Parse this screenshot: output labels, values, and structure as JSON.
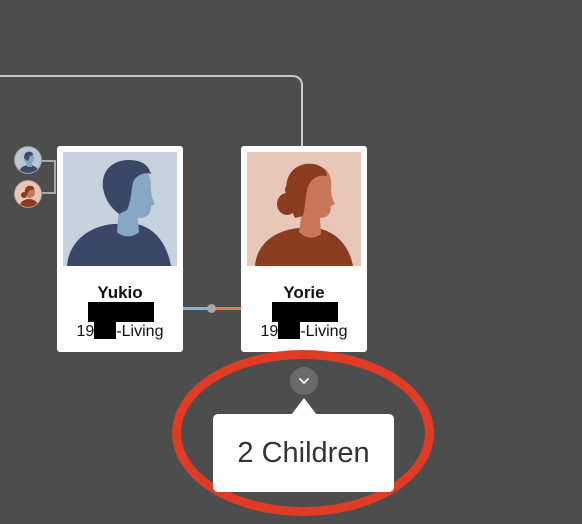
{
  "colors": {
    "background": "#4d4d4d",
    "card": "#ffffff",
    "male_link": "#8eb1c7",
    "female_link": "#d87c5a",
    "highlight": "#e03c25"
  },
  "parents": {
    "father_icon": "male-avatar-icon",
    "mother_icon": "female-avatar-icon"
  },
  "people": [
    {
      "name": "Yukio",
      "lifespan_prefix": "19",
      "lifespan_suffix": "-Living",
      "portrait": "male-silhouette"
    },
    {
      "name": "Yorie",
      "lifespan_prefix": "19",
      "lifespan_suffix": "-Living",
      "portrait": "female-silhouette"
    }
  ],
  "children": {
    "toggle_icon": "chevron-down-icon",
    "tooltip_text": "2 Children"
  }
}
